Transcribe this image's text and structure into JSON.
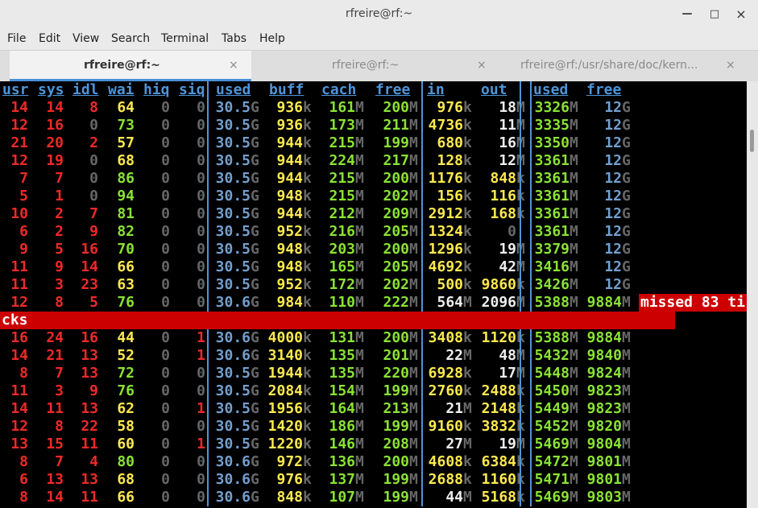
{
  "window": {
    "title": "rfreire@rf:~",
    "minimize_glyph": "—",
    "maximize_glyph": "□",
    "close_glyph": "×"
  },
  "menu": [
    "File",
    "Edit",
    "View",
    "Search",
    "Terminal",
    "Tabs",
    "Help"
  ],
  "tabs": [
    {
      "label": "rfreire@rf:~",
      "active": true
    },
    {
      "label": "rfreire@rf:~",
      "active": false
    },
    {
      "label": "rfreire@rf:/usr/share/doc/kern...",
      "active": false
    }
  ],
  "tab_close_glyph": "×",
  "headers": [
    "usr",
    "sys",
    "idl",
    "wai",
    "hiq",
    "siq",
    "used",
    "buff",
    "cach",
    "free",
    "in",
    "out",
    "used",
    "free"
  ],
  "rows": [
    [
      [
        "14",
        "",
        ""
      ],
      [
        "14",
        "",
        ""
      ],
      [
        "8",
        "",
        ""
      ],
      [
        "64",
        "",
        ""
      ],
      [
        "0",
        "",
        ""
      ],
      [
        "0",
        "",
        ""
      ],
      [
        "30.5",
        "G"
      ],
      [
        "936",
        "k"
      ],
      [
        "161",
        "M"
      ],
      [
        "200",
        "M"
      ],
      [
        "976",
        "k"
      ],
      [
        "18",
        "M"
      ],
      [
        "3326",
        "M"
      ],
      [
        "12",
        "G"
      ]
    ],
    [
      [
        "12"
      ],
      [
        "16"
      ],
      [
        "0"
      ],
      [
        "73"
      ],
      [
        "0"
      ],
      [
        "0"
      ],
      [
        "30.5",
        "G"
      ],
      [
        "936",
        "k"
      ],
      [
        "173",
        "M"
      ],
      [
        "211",
        "M"
      ],
      [
        "4736",
        "k"
      ],
      [
        "11",
        "M"
      ],
      [
        "3335",
        "M"
      ],
      [
        "12",
        "G"
      ]
    ],
    [
      [
        "21"
      ],
      [
        "20"
      ],
      [
        "2"
      ],
      [
        "57"
      ],
      [
        "0"
      ],
      [
        "0"
      ],
      [
        "30.5",
        "G"
      ],
      [
        "944",
        "k"
      ],
      [
        "215",
        "M"
      ],
      [
        "199",
        "M"
      ],
      [
        "680",
        "k"
      ],
      [
        "16",
        "M"
      ],
      [
        "3350",
        "M"
      ],
      [
        "12",
        "G"
      ]
    ],
    [
      [
        "12"
      ],
      [
        "19"
      ],
      [
        "0"
      ],
      [
        "68"
      ],
      [
        "0"
      ],
      [
        "0"
      ],
      [
        "30.5",
        "G"
      ],
      [
        "944",
        "k"
      ],
      [
        "224",
        "M"
      ],
      [
        "217",
        "M"
      ],
      [
        "128",
        "k"
      ],
      [
        "12",
        "M"
      ],
      [
        "3361",
        "M"
      ],
      [
        "12",
        "G"
      ]
    ],
    [
      [
        "7"
      ],
      [
        "7"
      ],
      [
        "0"
      ],
      [
        "86"
      ],
      [
        "0"
      ],
      [
        "0"
      ],
      [
        "30.5",
        "G"
      ],
      [
        "944",
        "k"
      ],
      [
        "215",
        "M"
      ],
      [
        "200",
        "M"
      ],
      [
        "1176",
        "k"
      ],
      [
        "848",
        "k"
      ],
      [
        "3361",
        "M"
      ],
      [
        "12",
        "G"
      ]
    ],
    [
      [
        "5"
      ],
      [
        "1"
      ],
      [
        "0"
      ],
      [
        "94"
      ],
      [
        "0"
      ],
      [
        "0"
      ],
      [
        "30.5",
        "G"
      ],
      [
        "948",
        "k"
      ],
      [
        "215",
        "M"
      ],
      [
        "202",
        "M"
      ],
      [
        "156",
        "k"
      ],
      [
        "116",
        "k"
      ],
      [
        "3361",
        "M"
      ],
      [
        "12",
        "G"
      ]
    ],
    [
      [
        "10"
      ],
      [
        "2"
      ],
      [
        "7"
      ],
      [
        "81"
      ],
      [
        "0"
      ],
      [
        "0"
      ],
      [
        "30.5",
        "G"
      ],
      [
        "944",
        "k"
      ],
      [
        "212",
        "M"
      ],
      [
        "209",
        "M"
      ],
      [
        "2912",
        "k"
      ],
      [
        "168",
        "k"
      ],
      [
        "3361",
        "M"
      ],
      [
        "12",
        "G"
      ]
    ],
    [
      [
        "6"
      ],
      [
        "2"
      ],
      [
        "9"
      ],
      [
        "82"
      ],
      [
        "0"
      ],
      [
        "0"
      ],
      [
        "30.5",
        "G"
      ],
      [
        "952",
        "k"
      ],
      [
        "216",
        "M"
      ],
      [
        "205",
        "M"
      ],
      [
        "1324",
        "k"
      ],
      [
        "0",
        ""
      ],
      [
        "3361",
        "M"
      ],
      [
        "12",
        "G"
      ]
    ],
    [
      [
        "9"
      ],
      [
        "5"
      ],
      [
        "16"
      ],
      [
        "70"
      ],
      [
        "0"
      ],
      [
        "0"
      ],
      [
        "30.5",
        "G"
      ],
      [
        "948",
        "k"
      ],
      [
        "203",
        "M"
      ],
      [
        "200",
        "M"
      ],
      [
        "1296",
        "k"
      ],
      [
        "19",
        "M"
      ],
      [
        "3379",
        "M"
      ],
      [
        "12",
        "G"
      ]
    ],
    [
      [
        "11"
      ],
      [
        "9"
      ],
      [
        "14"
      ],
      [
        "66"
      ],
      [
        "0"
      ],
      [
        "0"
      ],
      [
        "30.5",
        "G"
      ],
      [
        "948",
        "k"
      ],
      [
        "165",
        "M"
      ],
      [
        "205",
        "M"
      ],
      [
        "4692",
        "k"
      ],
      [
        "42",
        "M"
      ],
      [
        "3416",
        "M"
      ],
      [
        "12",
        "G"
      ]
    ],
    [
      [
        "11"
      ],
      [
        "3"
      ],
      [
        "23"
      ],
      [
        "63"
      ],
      [
        "0"
      ],
      [
        "0"
      ],
      [
        "30.5",
        "G"
      ],
      [
        "952",
        "k"
      ],
      [
        "172",
        "M"
      ],
      [
        "202",
        "M"
      ],
      [
        "500",
        "k"
      ],
      [
        "9860",
        "k"
      ],
      [
        "3426",
        "M"
      ],
      [
        "12",
        "G"
      ]
    ],
    [
      [
        "12"
      ],
      [
        "8"
      ],
      [
        "5"
      ],
      [
        "76"
      ],
      [
        "0"
      ],
      [
        "0"
      ],
      [
        "30.6",
        "G"
      ],
      [
        "984",
        "k"
      ],
      [
        "110",
        "M"
      ],
      [
        "222",
        "M"
      ],
      [
        "564",
        "M"
      ],
      [
        "2096",
        "M"
      ],
      [
        "5388",
        "M"
      ],
      [
        "9884",
        "M"
      ]
    ],
    null,
    [
      [
        "16"
      ],
      [
        "24"
      ],
      [
        "16"
      ],
      [
        "44"
      ],
      [
        "0"
      ],
      [
        "1"
      ],
      [
        "30.6",
        "G"
      ],
      [
        "4000",
        "k"
      ],
      [
        "131",
        "M"
      ],
      [
        "200",
        "M"
      ],
      [
        "3408",
        "k"
      ],
      [
        "1120",
        "k"
      ],
      [
        "5388",
        "M"
      ],
      [
        "9884",
        "M"
      ]
    ],
    [
      [
        "14"
      ],
      [
        "21"
      ],
      [
        "13"
      ],
      [
        "52"
      ],
      [
        "0"
      ],
      [
        "1"
      ],
      [
        "30.6",
        "G"
      ],
      [
        "3140",
        "k"
      ],
      [
        "135",
        "M"
      ],
      [
        "201",
        "M"
      ],
      [
        "22",
        "M"
      ],
      [
        "48",
        "M"
      ],
      [
        "5432",
        "M"
      ],
      [
        "9840",
        "M"
      ]
    ],
    [
      [
        "8"
      ],
      [
        "7"
      ],
      [
        "13"
      ],
      [
        "72"
      ],
      [
        "0"
      ],
      [
        "0"
      ],
      [
        "30.5",
        "G"
      ],
      [
        "1944",
        "k"
      ],
      [
        "135",
        "M"
      ],
      [
        "220",
        "M"
      ],
      [
        "6928",
        "k"
      ],
      [
        "17",
        "M"
      ],
      [
        "5448",
        "M"
      ],
      [
        "9824",
        "M"
      ]
    ],
    [
      [
        "11"
      ],
      [
        "3"
      ],
      [
        "9"
      ],
      [
        "76"
      ],
      [
        "0"
      ],
      [
        "0"
      ],
      [
        "30.5",
        "G"
      ],
      [
        "2084",
        "k"
      ],
      [
        "154",
        "M"
      ],
      [
        "199",
        "M"
      ],
      [
        "2760",
        "k"
      ],
      [
        "2488",
        "k"
      ],
      [
        "5450",
        "M"
      ],
      [
        "9823",
        "M"
      ]
    ],
    [
      [
        "14"
      ],
      [
        "11"
      ],
      [
        "13"
      ],
      [
        "62"
      ],
      [
        "0"
      ],
      [
        "1"
      ],
      [
        "30.5",
        "G"
      ],
      [
        "1956",
        "k"
      ],
      [
        "164",
        "M"
      ],
      [
        "213",
        "M"
      ],
      [
        "21",
        "M"
      ],
      [
        "2148",
        "k"
      ],
      [
        "5449",
        "M"
      ],
      [
        "9823",
        "M"
      ]
    ],
    [
      [
        "12"
      ],
      [
        "8"
      ],
      [
        "22"
      ],
      [
        "58"
      ],
      [
        "0"
      ],
      [
        "0"
      ],
      [
        "30.5",
        "G"
      ],
      [
        "1420",
        "k"
      ],
      [
        "186",
        "M"
      ],
      [
        "199",
        "M"
      ],
      [
        "9160",
        "k"
      ],
      [
        "3832",
        "k"
      ],
      [
        "5452",
        "M"
      ],
      [
        "9820",
        "M"
      ]
    ],
    [
      [
        "13"
      ],
      [
        "15"
      ],
      [
        "11"
      ],
      [
        "60"
      ],
      [
        "0"
      ],
      [
        "1"
      ],
      [
        "30.5",
        "G"
      ],
      [
        "1220",
        "k"
      ],
      [
        "146",
        "M"
      ],
      [
        "208",
        "M"
      ],
      [
        "27",
        "M"
      ],
      [
        "19",
        "M"
      ],
      [
        "5469",
        "M"
      ],
      [
        "9804",
        "M"
      ]
    ],
    [
      [
        "8"
      ],
      [
        "7"
      ],
      [
        "4"
      ],
      [
        "80"
      ],
      [
        "0"
      ],
      [
        "0"
      ],
      [
        "30.6",
        "G"
      ],
      [
        "972",
        "k"
      ],
      [
        "136",
        "M"
      ],
      [
        "200",
        "M"
      ],
      [
        "4608",
        "k"
      ],
      [
        "6384",
        "k"
      ],
      [
        "5472",
        "M"
      ],
      [
        "9801",
        "M"
      ]
    ],
    [
      [
        "6"
      ],
      [
        "13"
      ],
      [
        "13"
      ],
      [
        "68"
      ],
      [
        "0"
      ],
      [
        "0"
      ],
      [
        "30.6",
        "G"
      ],
      [
        "976",
        "k"
      ],
      [
        "137",
        "M"
      ],
      [
        "199",
        "M"
      ],
      [
        "2688",
        "k"
      ],
      [
        "1160",
        "k"
      ],
      [
        "5471",
        "M"
      ],
      [
        "9801",
        "M"
      ]
    ],
    [
      [
        "8"
      ],
      [
        "14"
      ],
      [
        "11"
      ],
      [
        "66"
      ],
      [
        "0"
      ],
      [
        "0"
      ],
      [
        "30.6",
        "G"
      ],
      [
        "848",
        "k"
      ],
      [
        "107",
        "M"
      ],
      [
        "199",
        "M"
      ],
      [
        "44",
        "M"
      ],
      [
        "5168",
        "k"
      ],
      [
        "5469",
        "M"
      ],
      [
        "9803",
        "M"
      ]
    ]
  ],
  "warning": {
    "line1": "missed 83 ti",
    "line2": "cks"
  },
  "colors": {
    "header": "#4f94d8",
    "cpu_high": "#ef2929",
    "cpu_mid": "#fce94f",
    "cpu_low": "#8ae234",
    "zero": "#666666",
    "mem_used": "#729fcf",
    "value_yellow": "#fce94f",
    "value_green": "#8ae234",
    "value_white": "#eeeeee",
    "unit": "#777777",
    "separator": "#4f94d8",
    "warning_bg": "#cc0000"
  }
}
